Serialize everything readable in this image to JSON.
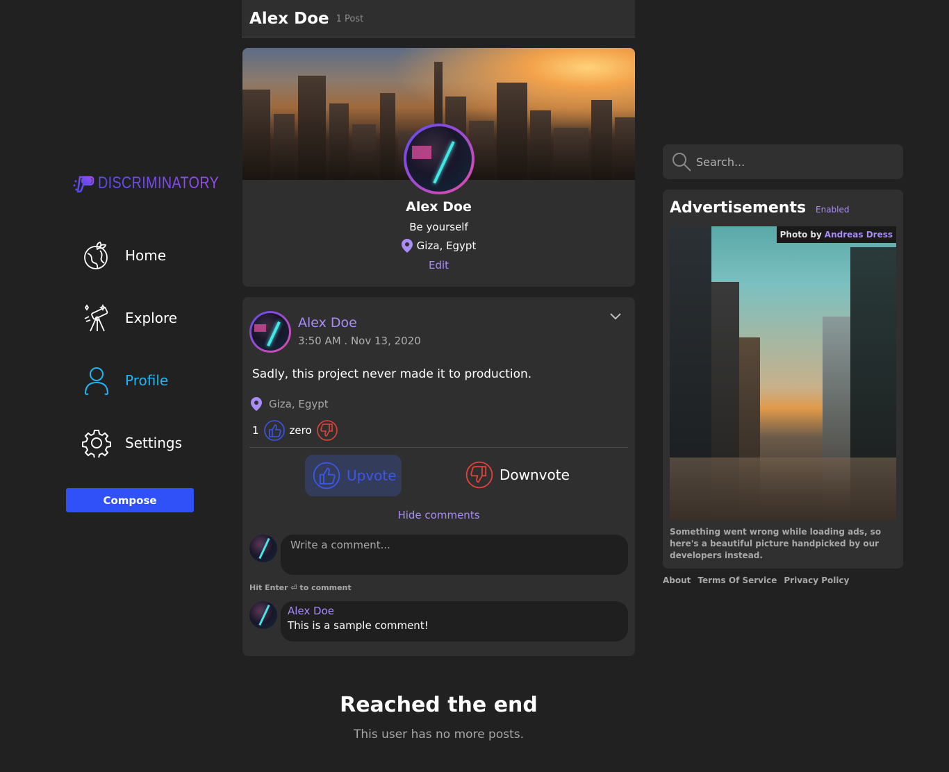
{
  "brand": {
    "name": "DISCRIMINATORY"
  },
  "nav": {
    "items": [
      {
        "label": "Home",
        "icon": "globe-plant-icon"
      },
      {
        "label": "Explore",
        "icon": "telescope-icon"
      },
      {
        "label": "Profile",
        "icon": "user-icon",
        "active": true
      },
      {
        "label": "Settings",
        "icon": "gear-icon"
      }
    ],
    "compose_label": "Compose"
  },
  "header": {
    "name": "Alex Doe",
    "post_count": "1 Post"
  },
  "profile": {
    "name": "Alex Doe",
    "bio": "Be yourself",
    "location": "Giza, Egypt",
    "edit_label": "Edit"
  },
  "post": {
    "author": "Alex Doe",
    "timestamp": "3:50 AM . Nov 13, 2020",
    "text": "Sadly, this project never made it to production.",
    "location": "Giza, Egypt",
    "upvote_count": "1",
    "downvote_count": "zero",
    "upvote_label": "Upvote",
    "downvote_label": "Downvote",
    "hide_comments_label": "Hide comments",
    "comment_placeholder": "Write a comment...",
    "comment_hint": "Hit Enter ⏎ to comment",
    "comments": [
      {
        "author": "Alex Doe",
        "text": "This is a sample comment!"
      }
    ]
  },
  "end": {
    "title": "Reached the end",
    "subtitle": "This user has no more posts."
  },
  "search": {
    "placeholder": "Search..."
  },
  "ads": {
    "title": "Advertisements",
    "badge": "Enabled",
    "credit_prefix": "Photo by",
    "credit_author": "Andreas Dress",
    "note": "Something went wrong while loading ads, so here's a beautiful picture handpicked by our developers instead."
  },
  "footer": {
    "links": [
      "About",
      "Terms Of Service",
      "Privacy Policy"
    ]
  },
  "colors": {
    "accent": "#a98cf6",
    "active_nav": "#1fb6f5",
    "compose": "#3050f8",
    "upvote": "#3b57e8",
    "downvote": "#e0443a"
  }
}
